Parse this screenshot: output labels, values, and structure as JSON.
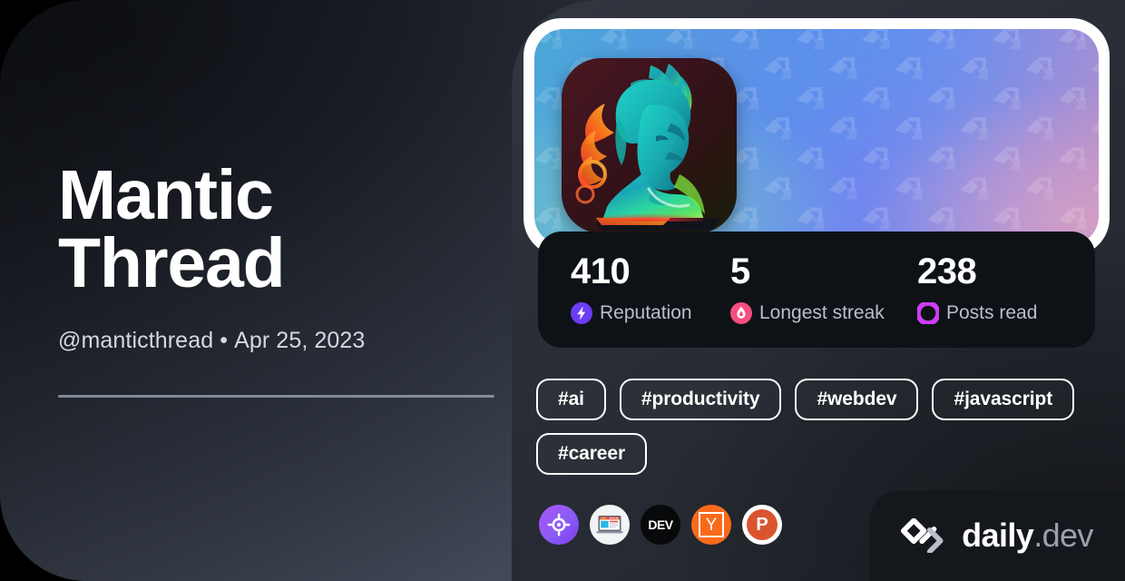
{
  "profile": {
    "display_name": "Mantic Thread",
    "handle": "@manticthread",
    "separator": "•",
    "joined_date": "Apr 25, 2023",
    "avatar_alt": "neon-shiva-statue-avatar"
  },
  "stats": [
    {
      "value": "410",
      "label": "Reputation",
      "icon": "reputation-bolt-icon",
      "color": "#6d3df5"
    },
    {
      "value": "5",
      "label": "Longest streak",
      "icon": "streak-flame-icon",
      "color": "#f64f7e"
    },
    {
      "value": "238",
      "label": "Posts read",
      "icon": "posts-read-ring-icon",
      "color": "#cd3df5"
    }
  ],
  "tags": [
    {
      "label": "#ai"
    },
    {
      "label": "#productivity"
    },
    {
      "label": "#webdev"
    },
    {
      "label": "#javascript"
    },
    {
      "label": "#career"
    }
  ],
  "sources": [
    {
      "name": "squad-target-icon",
      "label": ""
    },
    {
      "name": "web-browser-icon",
      "label": ""
    },
    {
      "name": "devto-icon",
      "label": "DEV"
    },
    {
      "name": "hackernews-icon",
      "label": "Y"
    },
    {
      "name": "producthunt-icon",
      "label": "P"
    }
  ],
  "brand": {
    "name": "daily",
    "suffix": ".dev",
    "mark": "daily-dev-logo-icon"
  },
  "colors": {
    "accent_purple": "#6d3df5",
    "accent_pink": "#f64f7e",
    "accent_magenta": "#cd3df5",
    "panel_dark": "#0e1217",
    "brand_dark": "#14171c",
    "text_primary": "#ffffff",
    "text_secondary": "#b9bfc9"
  }
}
